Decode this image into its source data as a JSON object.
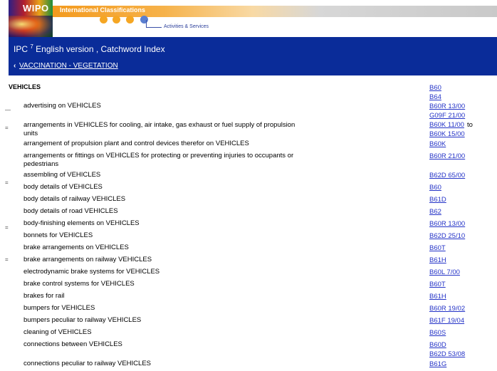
{
  "header": {
    "logo": "WIPO",
    "title": "International Classifications",
    "activities": "Activities & Services"
  },
  "bar": {
    "title": "IPC",
    "edition": "7",
    "title_rest": "English version , Catchword Index",
    "back_link": "VACCINATION - VEGETATION"
  },
  "index": {
    "heading": "VEHICLES",
    "heading_codes": [
      "B60",
      "B64"
    ],
    "entries": [
      {
        "term": "advertising on VEHICLES",
        "codes": [
          "B60R 13/00",
          "G09F 21/00"
        ]
      },
      {
        "term": "arrangements in VEHICLES for cooling, air intake, gas exhaust or fuel supply of propulsion units",
        "codes": [
          "B60K 11/00",
          "B60K 15/00"
        ],
        "joiner": "to"
      },
      {
        "term": "arrangement of propulsion plant and control devices therefor on VEHICLES",
        "codes": [
          "B60K"
        ]
      },
      {
        "term": "arrangements or fittings on VEHICLES for protecting or preventing injuries to occupants or pedestrians",
        "codes": [
          "B60R 21/00"
        ]
      },
      {
        "term": "assembling of VEHICLES",
        "codes": [
          "B62D 65/00"
        ]
      },
      {
        "term": "body details of VEHICLES",
        "codes": [
          "B60"
        ]
      },
      {
        "term": "body details of railway VEHICLES",
        "codes": [
          "B61D"
        ]
      },
      {
        "term": "body details of road VEHICLES",
        "codes": [
          "B62"
        ]
      },
      {
        "term": "body-finishing elements on VEHICLES",
        "codes": [
          "B60R 13/00"
        ]
      },
      {
        "term": "bonnets for VEHICLES",
        "codes": [
          "B62D 25/10"
        ]
      },
      {
        "term": "brake arrangements on VEHICLES",
        "codes": [
          "B60T"
        ]
      },
      {
        "term": "brake arrangements on railway VEHICLES",
        "codes": [
          "B61H"
        ]
      },
      {
        "term": "electrodynamic brake systems for VEHICLES",
        "codes": [
          "B60L 7/00"
        ]
      },
      {
        "term": "brake control systems for VEHICLES",
        "codes": [
          "B60T"
        ]
      },
      {
        "term": "brakes for rail",
        "codes": [
          "B61H"
        ]
      },
      {
        "term": "bumpers for VEHICLES",
        "codes": [
          "B60R 19/02"
        ]
      },
      {
        "term": "bumpers peculiar to railway VEHICLES",
        "codes": [
          "B61F 19/04"
        ]
      },
      {
        "term": "cleaning of VEHICLES",
        "codes": [
          "B60S"
        ]
      },
      {
        "term": "connections between VEHICLES",
        "codes": [
          "B60D",
          "B62D 53/08"
        ]
      },
      {
        "term": "connections peculiar to railway VEHICLES",
        "codes": [
          "B61G"
        ]
      }
    ]
  }
}
